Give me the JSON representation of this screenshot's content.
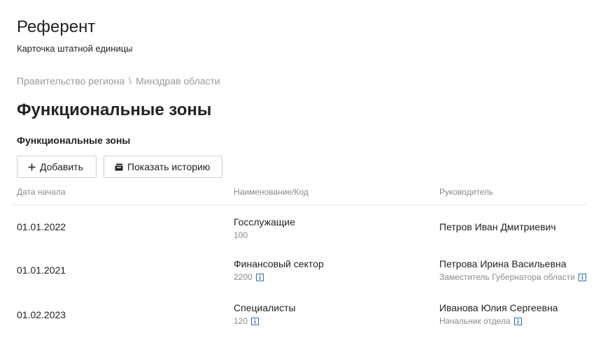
{
  "header": {
    "title": "Референт",
    "subtitle": "Карточка штатной единицы"
  },
  "breadcrumb": {
    "items": [
      "Правительство региона",
      "Минздрав области"
    ],
    "separator": "\\"
  },
  "section": {
    "title": "Функциональные зоны",
    "subtitle": "Функциональные зоны"
  },
  "toolbar": {
    "add_label": "Добавить",
    "add_icon": "plus-icon",
    "history_label": "Показать историю",
    "history_icon": "archive-icon"
  },
  "table": {
    "columns": [
      "Дата начала",
      "Наименование/Код",
      "Руководитель"
    ],
    "rows": [
      {
        "date": "01.01.2022",
        "name": "Госслужащие",
        "code": "100",
        "code_info": false,
        "head_name": "Петров Иван Дмитриевич",
        "head_title": "",
        "head_info": false
      },
      {
        "date": "01.01.2021",
        "name": "Финансовый сектор",
        "code": "2200",
        "code_info": true,
        "head_name": "Петрова Ирина Васильевна",
        "head_title": "Заместитель Губернатора области",
        "head_info": true
      },
      {
        "date": "01.02.2023",
        "name": "Специалисты",
        "code": "120",
        "code_info": true,
        "head_name": "Иванова Юлия Сергеевна",
        "head_title": "Начальник отдела",
        "head_info": true
      }
    ]
  },
  "colors": {
    "text": "#222222",
    "muted": "#8a8a8a",
    "info_icon": "#2a6fb0",
    "border": "#cfcfcf"
  }
}
